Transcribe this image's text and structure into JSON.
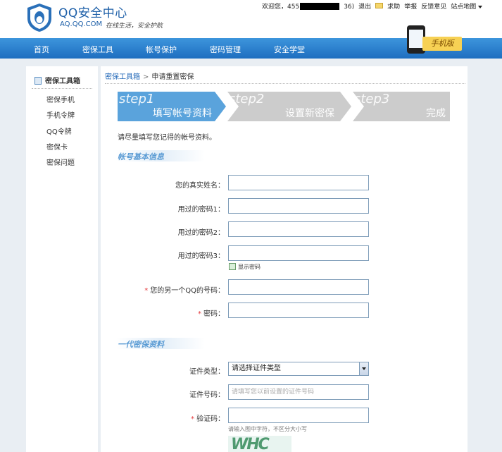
{
  "header": {
    "title": "QQ安全中心",
    "domain": "AQ.QQ.COM",
    "slogan": "在线生活，安全护航"
  },
  "toplinks": {
    "welcome_prefix": "欢迎您，455",
    "welcome_suffix": "36)",
    "logout": "退出",
    "help": "求助",
    "report": "举报",
    "feedback": "反馈意见",
    "sitemap": "站点地图"
  },
  "nav": {
    "items": [
      "首页",
      "密保工具",
      "帐号保护",
      "密码管理",
      "安全学堂"
    ],
    "mobile_badge": "手机版"
  },
  "sidebar": {
    "title": "密保工具箱",
    "items": [
      "密保手机",
      "手机令牌",
      "QQ令牌",
      "密保卡",
      "密保问题"
    ]
  },
  "breadcrumb": {
    "parent": "密保工具箱",
    "sep": ">",
    "current": "申请重置密保"
  },
  "steps": [
    {
      "en": "step1",
      "cn": "填写帐号资料",
      "active": true
    },
    {
      "en": "step2",
      "cn": "设置新密保",
      "active": false
    },
    {
      "en": "step3",
      "cn": "完成",
      "active": false
    }
  ],
  "form": {
    "intro": "请尽量填写您记得的帐号资料。",
    "section1": "帐号基本信息",
    "real_name_label": "您的真实姓名：",
    "pwd1_label": "用过的密码1：",
    "pwd2_label": "用过的密码2：",
    "pwd3_label": "用过的密码3：",
    "show_password": "显示密码",
    "other_qq_label": "您的另一个QQ的号码：",
    "password_label": "密码：",
    "required_mark": "*",
    "section2": "一代密保资料",
    "id_type_label": "证件类型：",
    "id_type_value": "请选择证件类型",
    "id_number_label": "证件号码：",
    "id_number_placeholder": "请填写您以前设置的证件号码",
    "captcha_label": "验证码：",
    "captcha_hint": "请输入图中字符，不区分大小写",
    "captcha_text": "WHC"
  },
  "colors": {
    "nav_blue": "#1e6ec0",
    "step_active": "#5aa3dc",
    "step_inactive": "#cccccc",
    "required_red": "#e4393c"
  }
}
